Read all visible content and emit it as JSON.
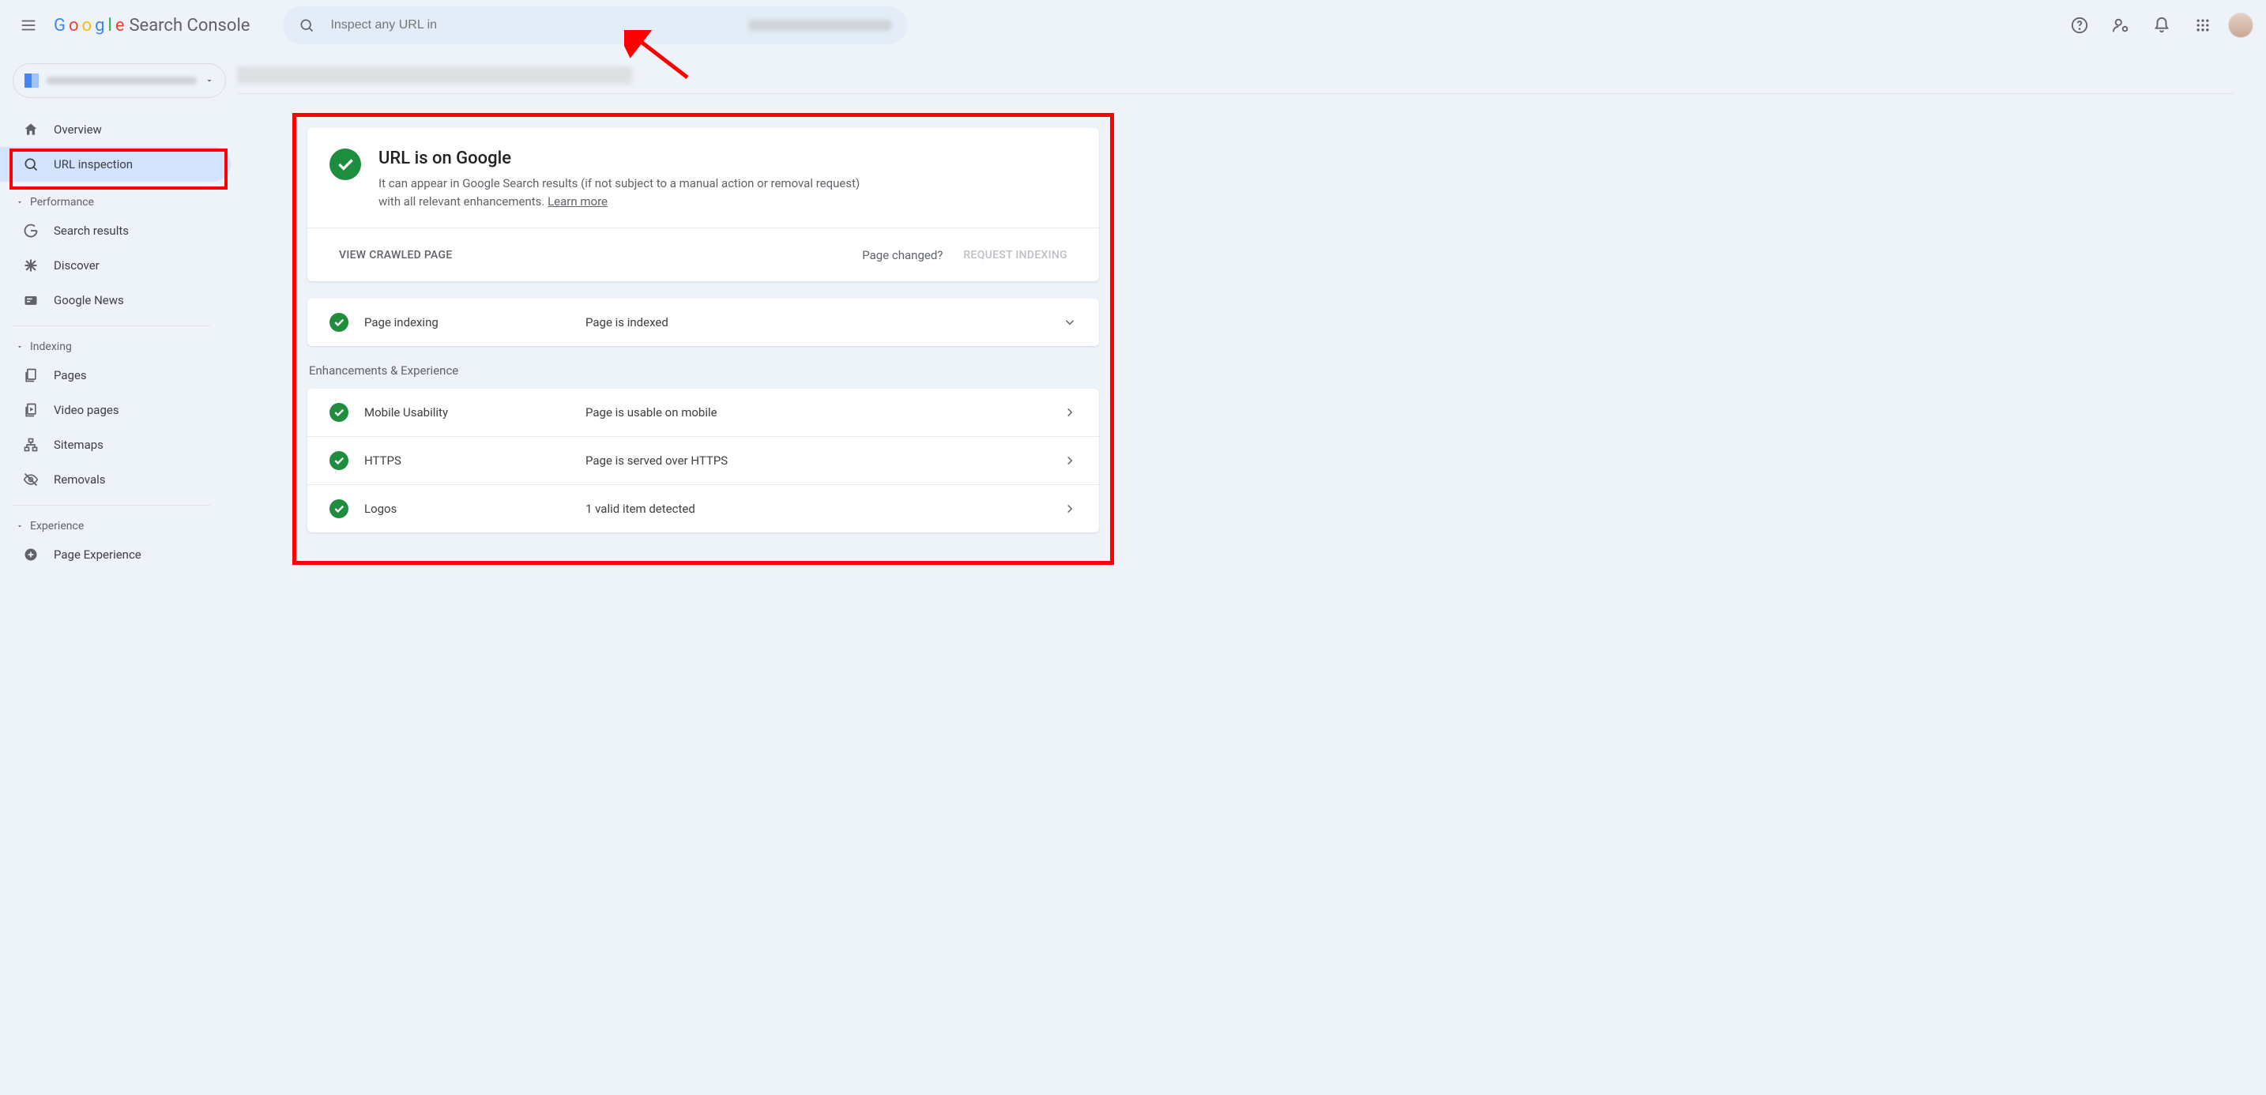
{
  "app": {
    "name": "Search Console"
  },
  "search": {
    "placeholder": "Inspect any URL in"
  },
  "sidebar": {
    "overview": "Overview",
    "url_inspection": "URL inspection",
    "sections": {
      "performance": "Performance",
      "indexing": "Indexing",
      "experience": "Experience"
    },
    "perf_items": {
      "search_results": "Search results",
      "discover": "Discover",
      "google_news": "Google News"
    },
    "index_items": {
      "pages": "Pages",
      "video_pages": "Video pages",
      "sitemaps": "Sitemaps",
      "removals": "Removals"
    },
    "exp_items": {
      "page_experience": "Page Experience"
    }
  },
  "status": {
    "title": "URL is on Google",
    "desc_a": "It can appear in Google Search results (if not subject to a manual action or removal request) with all relevant enhancements. ",
    "learn_more": "Learn more",
    "view_crawled": "VIEW CRAWLED PAGE",
    "page_changed": "Page changed?",
    "request_indexing": "REQUEST INDEXING"
  },
  "indexing_row": {
    "label": "Page indexing",
    "value": "Page is indexed"
  },
  "enhancements_heading": "Enhancements & Experience",
  "rows": [
    {
      "label": "Mobile Usability",
      "value": "Page is usable on mobile"
    },
    {
      "label": "HTTPS",
      "value": "Page is served over HTTPS"
    },
    {
      "label": "Logos",
      "value": "1 valid item detected"
    }
  ]
}
